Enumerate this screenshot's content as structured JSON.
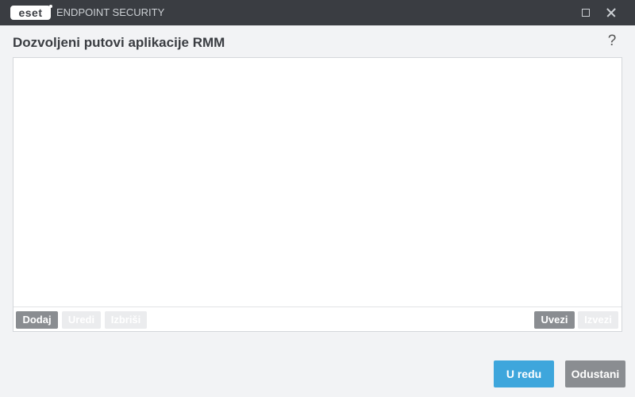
{
  "window": {
    "logo_text": "eset",
    "app_title": "ENDPOINT SECURITY",
    "maximize_icon": "maximize-icon",
    "close_icon": "close-icon"
  },
  "dialog": {
    "title": "Dozvoljeni putovi aplikacije RMM",
    "help_label": "?"
  },
  "list": {
    "items": [],
    "toolbar": {
      "add_label": "Dodaj",
      "edit_label": "Uredi",
      "delete_label": "Izbriši",
      "import_label": "Uvezi",
      "export_label": "Izvezi"
    }
  },
  "footer": {
    "ok_label": "U redu",
    "cancel_label": "Odustani"
  },
  "colors": {
    "titlebar": "#3a3d42",
    "primary_button": "#3ea6dc",
    "secondary_button": "#8a8d91",
    "disabled_button": "#ebecee"
  }
}
